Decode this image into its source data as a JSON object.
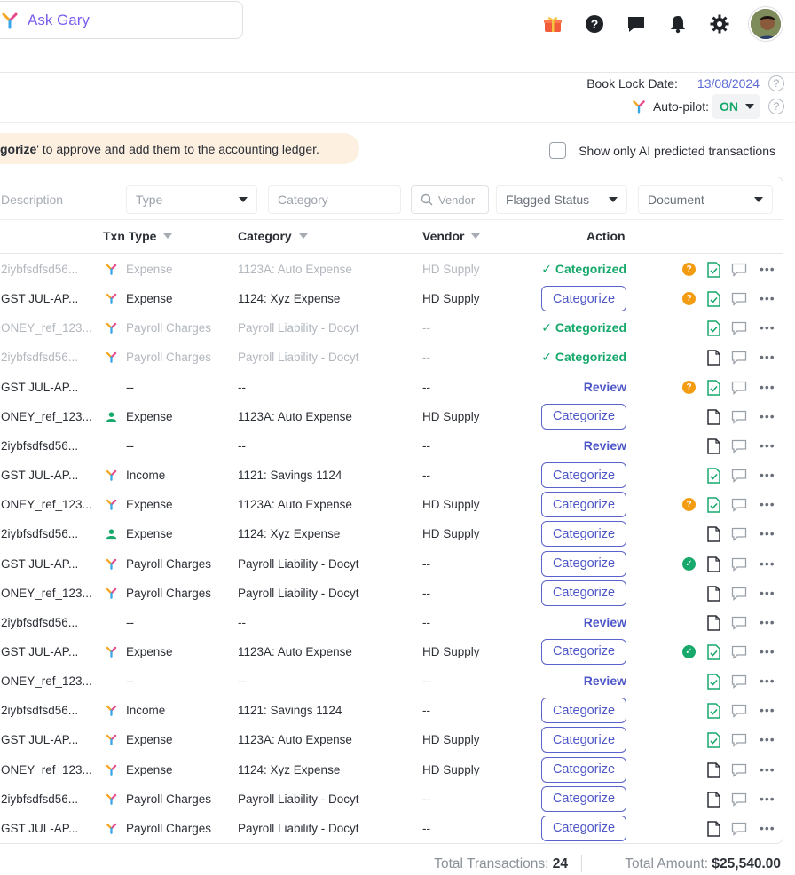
{
  "header": {
    "ask_gary_label": "Ask Gary",
    "icons": [
      "gift-icon",
      "help-icon",
      "chat-icon",
      "bell-icon",
      "gear-icon",
      "avatar"
    ]
  },
  "book_lock": {
    "label": "Book Lock Date:",
    "value": "13/08/2024"
  },
  "autopilot": {
    "label": "Auto-pilot:",
    "value": "ON"
  },
  "banner": {
    "bold": "gorize",
    "text": "' to approve and add them to the accounting ledger."
  },
  "ai_filter": {
    "label": "Show only AI predicted transactions"
  },
  "filters": {
    "description_placeholder": "Description",
    "type_placeholder": "Type",
    "category_placeholder": "Category",
    "vendor_placeholder": "Vendor",
    "flagged_status": "Flagged Status",
    "document": "Document"
  },
  "columns": {
    "txn_type": "Txn Type",
    "category": "Category",
    "vendor": "Vendor",
    "action": "Action"
  },
  "rows": [
    {
      "desc": "2iybfsdfsd56...",
      "icon": "gary",
      "txn": "Expense",
      "cat": "1123A: Auto Expense",
      "ven": "HD Supply",
      "action": "categorized",
      "flag": "q",
      "doc": "ok",
      "dim": true
    },
    {
      "desc": "GST JUL-AP...",
      "icon": "gary",
      "txn": "Expense",
      "cat": "1124: Xyz Expense",
      "ven": "HD Supply",
      "action": "categorize",
      "flag": "q",
      "doc": "ok",
      "dim": false
    },
    {
      "desc": "ONEY_ref_123...",
      "icon": "gary",
      "txn": "Payroll Charges",
      "cat": "Payroll Liability - Docyt",
      "ven": "--",
      "action": "categorized",
      "flag": "",
      "doc": "ok",
      "dim": true
    },
    {
      "desc": "2iybfsdfsd56...",
      "icon": "gary",
      "txn": "Payroll Charges",
      "cat": "Payroll Liability - Docyt",
      "ven": "--",
      "action": "categorized",
      "flag": "",
      "doc": "plain",
      "dim": true
    },
    {
      "desc": "GST JUL-AP...",
      "icon": "",
      "txn": "--",
      "cat": "--",
      "ven": "--",
      "action": "review",
      "flag": "q",
      "doc": "ok",
      "dim": false
    },
    {
      "desc": "ONEY_ref_123...",
      "icon": "user",
      "txn": "Expense",
      "cat": "1123A: Auto Expense",
      "ven": "HD Supply",
      "action": "categorize",
      "flag": "",
      "doc": "plain",
      "dim": false
    },
    {
      "desc": "2iybfsdfsd56...",
      "icon": "",
      "txn": "--",
      "cat": "--",
      "ven": "--",
      "action": "review",
      "flag": "",
      "doc": "plain",
      "dim": false
    },
    {
      "desc": "GST JUL-AP...",
      "icon": "gary",
      "txn": "Income",
      "cat": "1121: Savings 1124",
      "ven": "--",
      "action": "categorize",
      "flag": "",
      "doc": "ok",
      "dim": false
    },
    {
      "desc": "ONEY_ref_123...",
      "icon": "gary",
      "txn": "Expense",
      "cat": "1123A: Auto Expense",
      "ven": "HD Supply",
      "action": "categorize",
      "flag": "q",
      "doc": "ok",
      "dim": false
    },
    {
      "desc": "2iybfsdfsd56...",
      "icon": "user",
      "txn": "Expense",
      "cat": "1124: Xyz Expense",
      "ven": "HD Supply",
      "action": "categorize",
      "flag": "",
      "doc": "plain",
      "dim": false
    },
    {
      "desc": "GST JUL-AP...",
      "icon": "gary",
      "txn": "Payroll Charges",
      "cat": "Payroll Liability - Docyt",
      "ven": "--",
      "action": "categorize",
      "flag": "ok",
      "doc": "plain",
      "dim": false
    },
    {
      "desc": "ONEY_ref_123...",
      "icon": "gary",
      "txn": "Payroll Charges",
      "cat": "Payroll Liability - Docyt",
      "ven": "--",
      "action": "categorize",
      "flag": "",
      "doc": "plain",
      "dim": false
    },
    {
      "desc": "2iybfsdfsd56...",
      "icon": "",
      "txn": "--",
      "cat": "--",
      "ven": "--",
      "action": "review",
      "flag": "",
      "doc": "plain",
      "dim": false
    },
    {
      "desc": "GST JUL-AP...",
      "icon": "gary",
      "txn": "Expense",
      "cat": "1123A: Auto Expense",
      "ven": "HD Supply",
      "action": "categorize",
      "flag": "ok",
      "doc": "ok",
      "dim": false
    },
    {
      "desc": "ONEY_ref_123...",
      "icon": "",
      "txn": "--",
      "cat": "--",
      "ven": "--",
      "action": "review",
      "flag": "",
      "doc": "ok",
      "dim": false
    },
    {
      "desc": "2iybfsdfsd56...",
      "icon": "gary",
      "txn": "Income",
      "cat": "1121: Savings 1124",
      "ven": "--",
      "action": "categorize",
      "flag": "",
      "doc": "ok",
      "dim": false
    },
    {
      "desc": "GST JUL-AP...",
      "icon": "gary",
      "txn": "Expense",
      "cat": "1123A: Auto Expense",
      "ven": "HD Supply",
      "action": "categorize",
      "flag": "",
      "doc": "ok",
      "dim": false
    },
    {
      "desc": "ONEY_ref_123...",
      "icon": "gary",
      "txn": "Expense",
      "cat": "1124: Xyz Expense",
      "ven": "HD Supply",
      "action": "categorize",
      "flag": "",
      "doc": "plain",
      "dim": false
    },
    {
      "desc": "2iybfsdfsd56...",
      "icon": "gary",
      "txn": "Payroll Charges",
      "cat": "Payroll Liability - Docyt",
      "ven": "--",
      "action": "categorize",
      "flag": "",
      "doc": "plain",
      "dim": false
    },
    {
      "desc": "GST JUL-AP...",
      "icon": "gary",
      "txn": "Payroll Charges",
      "cat": "Payroll Liability - Docyt",
      "ven": "--",
      "action": "categorize",
      "flag": "",
      "doc": "plain",
      "dim": false
    }
  ],
  "labels": {
    "categorize": "Categorize",
    "categorized": "Categorized",
    "review": "Review"
  },
  "footer": {
    "total_transactions_label": "Total Transactions:",
    "total_transactions_value": "24",
    "total_amount_label": "Total Amount:",
    "total_amount_value": "$25,540.00"
  },
  "colors": {
    "accent": "#4e57c7",
    "success": "#17a86b",
    "warning": "#f39c12",
    "link": "#5c6bd6"
  }
}
